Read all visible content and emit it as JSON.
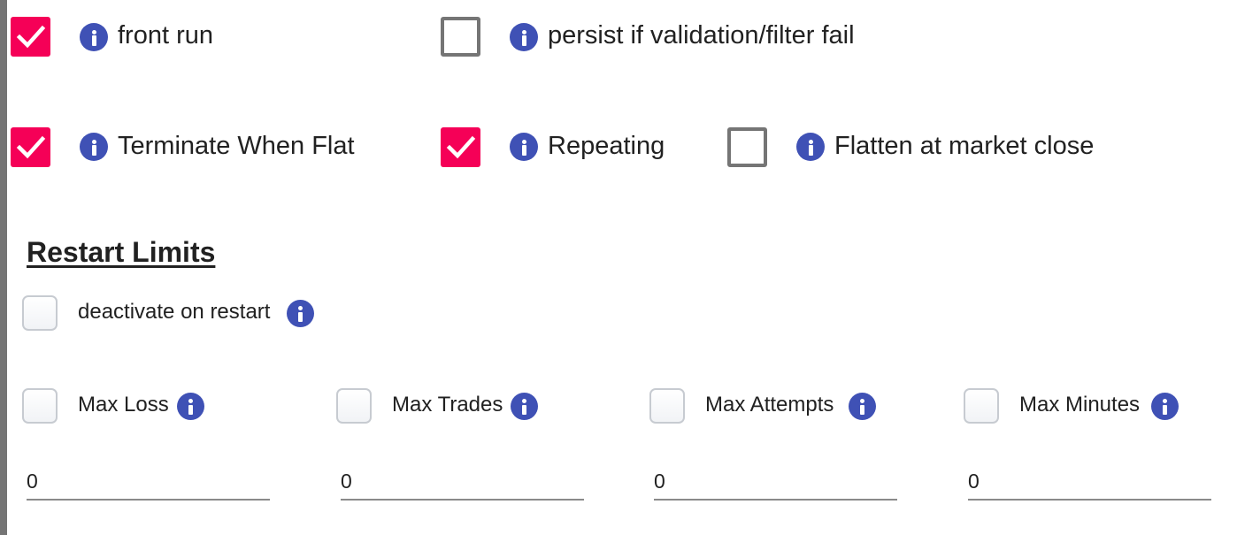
{
  "options": {
    "front_run": {
      "label": "front run",
      "checked": true
    },
    "persist_fail": {
      "label": "persist if validation/filter fail",
      "checked": false
    },
    "terminate_flat": {
      "label": "Terminate When Flat",
      "checked": true
    },
    "repeating": {
      "label": "Repeating",
      "checked": true
    },
    "flatten_close": {
      "label": "Flatten at market close",
      "checked": false
    }
  },
  "restart": {
    "title": "Restart Limits",
    "deactivate_label": "deactivate on restart",
    "max_loss": {
      "label": "Max Loss",
      "value": "0"
    },
    "max_trades": {
      "label": "Max Trades",
      "value": "0"
    },
    "max_attempts": {
      "label": "Max Attempts",
      "value": "0"
    },
    "max_minutes": {
      "label": "Max Minutes",
      "value": "0"
    }
  },
  "colors": {
    "checked": "#f50057",
    "info": "#3f51b5",
    "unchecked_border": "#757575"
  }
}
